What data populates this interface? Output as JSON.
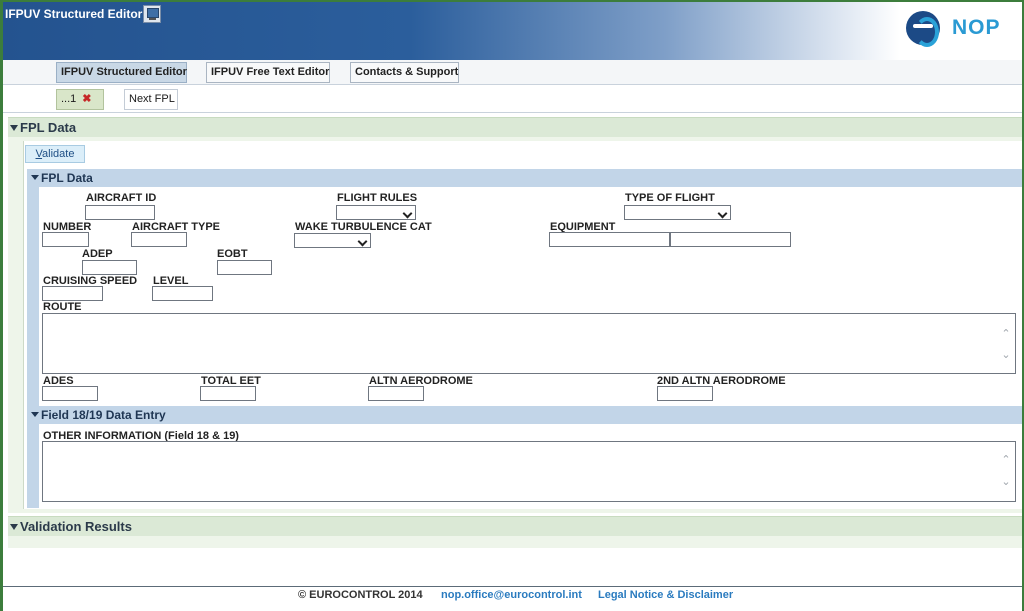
{
  "window": {
    "title": "IFPUV Structured Editor",
    "monitor_icon": "monitor-icon"
  },
  "brand": {
    "logo_text": "NOP",
    "logo_icon": "eurocontrol-logo-icon",
    "accent": "#2a9ad3",
    "header_dark": "#24538f"
  },
  "tabs": [
    {
      "label": "IFPUV Structured Editor",
      "active": true
    },
    {
      "label": "IFPUV Free Text Editor",
      "active": false
    },
    {
      "label": "Contacts & Support",
      "active": false
    }
  ],
  "subtabs": [
    {
      "label": "...1",
      "active": true,
      "close_icon": "close-icon"
    },
    {
      "label": "Next FPL",
      "active": false
    }
  ],
  "fpl_panel": {
    "title": "FPL Data",
    "validate_button": {
      "label_first": "V",
      "label_rest": "alidate"
    },
    "section_fpl": {
      "title": "FPL Data",
      "labels": {
        "aircraft_id": "AIRCRAFT ID",
        "flight_rules": "FLIGHT RULES",
        "type_of_flight": "TYPE OF FLIGHT",
        "number": "NUMBER",
        "aircraft_type": "AIRCRAFT TYPE",
        "wake_turbulence": "WAKE TURBULENCE CAT",
        "equipment": "EQUIPMENT",
        "adep": "ADEP",
        "eobt": "EOBT",
        "cruising_speed": "CRUISING SPEED",
        "level": "LEVEL",
        "route": "ROUTE",
        "ades": "ADES",
        "total_eet": "TOTAL EET",
        "altn_aerodrome": "ALTN AERODROME",
        "altn2_aerodrome": "2ND ALTN AERODROME"
      },
      "values": {
        "aircraft_id": "",
        "flight_rules": "",
        "type_of_flight": "",
        "number": "",
        "aircraft_type": "",
        "wake_turbulence": "",
        "equipment_1": "",
        "equipment_2": "",
        "adep": "",
        "eobt": "",
        "cruising_speed": "",
        "level": "",
        "route": "",
        "ades": "",
        "total_eet": "",
        "altn_aerodrome": "",
        "altn2_aerodrome": ""
      }
    },
    "section_field18": {
      "title": "Field 18/19 Data Entry",
      "other_info_label": "OTHER INFORMATION (Field 18 & 19)",
      "other_info_value": ""
    }
  },
  "validation_panel": {
    "title": "Validation Results"
  },
  "footer": {
    "copyright": "© EUROCONTROL 2014",
    "email": "nop.office@eurocontrol.int",
    "legal": "Legal Notice & Disclaimer"
  }
}
